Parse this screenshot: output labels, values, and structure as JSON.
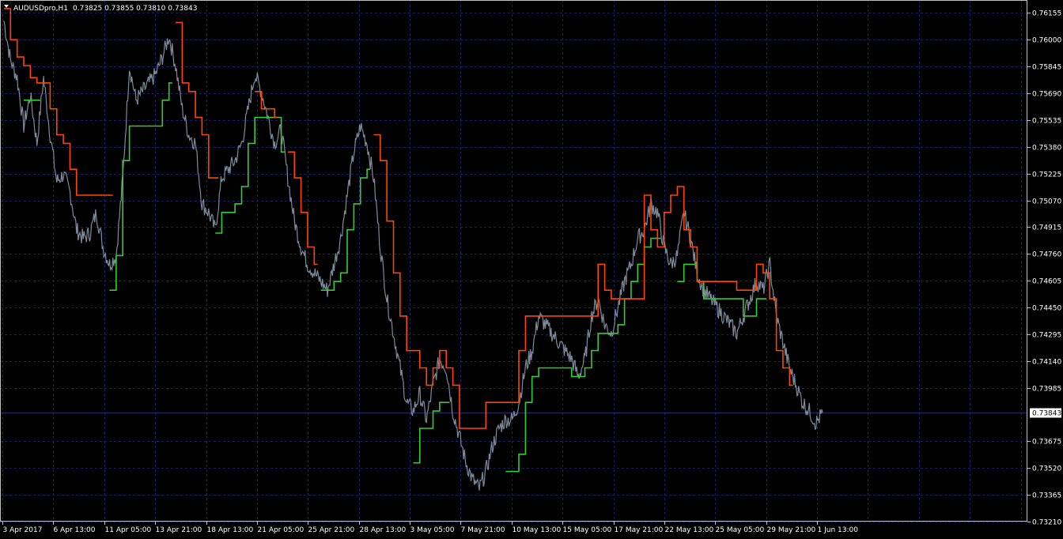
{
  "header": {
    "symbol": "AUDUSDpro,H1",
    "ohlc": "0.73825 0.73855 0.73810 0.73843"
  },
  "colors": {
    "background": "#000000",
    "grid": "#1e1e5a",
    "price": "#7f8a9a",
    "trail_up": "#33cc33",
    "trail_down": "#ff4500",
    "price_marker_bg": "#ffffff",
    "price_marker_line": "#2a2a66"
  },
  "chart_data": {
    "type": "line",
    "ylim": [
      0.7321,
      0.7623
    ],
    "y_ticks": [
      "0.76155",
      "0.76000",
      "0.75845",
      "0.75690",
      "0.75535",
      "0.75380",
      "0.75225",
      "0.75070",
      "0.74915",
      "0.74760",
      "0.74605",
      "0.74450",
      "0.74295",
      "0.74140",
      "0.73985",
      "0.73675",
      "0.73520",
      "0.73365",
      "0.73210"
    ],
    "current_price": "0.73843",
    "x_ticks": [
      "3 Apr 2017",
      "6 Apr 13:00",
      "11 Apr 05:00",
      "13 Apr 21:00",
      "18 Apr 13:00",
      "21 Apr 05:00",
      "25 Apr 21:00",
      "28 Apr 13:00",
      "3 May 05:00",
      "7 May 21:00",
      "10 May 13:00",
      "15 May 05:00",
      "17 May 21:00",
      "22 May 13:00",
      "25 May 05:00",
      "29 May 21:00",
      "1 Jun 13:00"
    ],
    "grid": true,
    "series": [
      {
        "values": [
          0.7611,
          0.7588,
          0.7578,
          0.755,
          0.7568,
          0.754,
          0.7578,
          0.7545,
          0.7518,
          0.7522,
          0.7512,
          0.749,
          0.7485,
          0.7488,
          0.75,
          0.748,
          0.747,
          0.7475,
          0.752,
          0.7585,
          0.7565,
          0.757,
          0.7575,
          0.758,
          0.759,
          0.7602,
          0.7585,
          0.756,
          0.7545,
          0.754,
          0.7505,
          0.75,
          0.749,
          0.752,
          0.7525,
          0.753,
          0.754,
          0.756,
          0.758,
          0.757,
          0.7555,
          0.754,
          0.7548,
          0.752,
          0.7495,
          0.748,
          0.747,
          0.7465,
          0.746,
          0.7455,
          0.747,
          0.7485,
          0.751,
          0.7535,
          0.755,
          0.754,
          0.752,
          0.748,
          0.745,
          0.743,
          0.741,
          0.739,
          0.7385,
          0.7395,
          0.738,
          0.74,
          0.7415,
          0.741,
          0.7385,
          0.737,
          0.7355,
          0.7345,
          0.734,
          0.735,
          0.7365,
          0.7375,
          0.738,
          0.738,
          0.739,
          0.741,
          0.742,
          0.744,
          0.7435,
          0.743,
          0.7425,
          0.742,
          0.7415,
          0.7405,
          0.7415,
          0.744,
          0.745,
          0.7435,
          0.743,
          0.7445,
          0.746,
          0.747,
          0.7485,
          0.749,
          0.7505,
          0.75,
          0.748,
          0.747,
          0.7475,
          0.75,
          0.7485,
          0.7465,
          0.7455,
          0.745,
          0.7445,
          0.744,
          0.7435,
          0.743,
          0.744,
          0.745,
          0.746,
          0.7455,
          0.747,
          0.744,
          0.7425,
          0.741,
          0.74,
          0.739,
          0.7385,
          0.7378,
          0.7384
        ]
      },
      {
        "name_hidden": true,
        "values": [
          null,
          null,
          null,
          0.7565,
          0.7565,
          0.7565,
          null,
          null,
          null,
          null,
          null,
          null,
          null,
          null,
          null,
          null,
          0.7455,
          0.7475,
          0.753,
          0.755,
          0.755,
          0.755,
          0.755,
          0.755,
          0.7565,
          0.7575,
          null,
          null,
          null,
          null,
          null,
          null,
          0.7488,
          0.75,
          0.75,
          0.7505,
          0.7515,
          0.754,
          0.7555,
          0.7555,
          0.7555,
          0.7555,
          0.7535,
          null,
          null,
          null,
          null,
          null,
          0.7455,
          0.7455,
          0.746,
          0.7465,
          0.749,
          0.7505,
          0.752,
          0.7525,
          null,
          null,
          null,
          null,
          null,
          null,
          0.7355,
          0.7375,
          0.7375,
          0.7385,
          0.739,
          0.739,
          null,
          null,
          null,
          null,
          null,
          null,
          null,
          null,
          0.735,
          0.735,
          0.736,
          0.739,
          0.7405,
          0.741,
          0.741,
          0.741,
          0.741,
          0.741,
          0.7405,
          0.7405,
          0.741,
          0.742,
          0.743,
          0.743,
          0.743,
          0.7435,
          0.745,
          0.746,
          0.747,
          0.748,
          0.7485,
          0.7485,
          null,
          null,
          0.746,
          0.747,
          0.747,
          0.746,
          0.745,
          0.745,
          0.745,
          0.745,
          0.745,
          0.745,
          0.744,
          0.744,
          0.745,
          0.745,
          null,
          null,
          null,
          null,
          null,
          null,
          null,
          null,
          null
        ]
      },
      {
        "name_hidden": true,
        "values": [
          0.7618,
          0.76,
          0.759,
          0.7585,
          0.7578,
          0.7575,
          0.7575,
          0.756,
          0.7545,
          0.754,
          0.7525,
          0.751,
          0.751,
          0.751,
          0.751,
          0.751,
          0.751,
          null,
          null,
          null,
          null,
          null,
          null,
          null,
          null,
          null,
          0.761,
          0.7575,
          0.757,
          0.7555,
          0.7545,
          0.752,
          0.752,
          null,
          null,
          null,
          null,
          null,
          0.757,
          0.756,
          0.756,
          0.7555,
          null,
          0.7535,
          0.752,
          0.75,
          0.748,
          0.747,
          null,
          null,
          null,
          null,
          null,
          null,
          null,
          null,
          0.7545,
          0.753,
          0.7495,
          0.7465,
          0.744,
          0.742,
          0.742,
          0.741,
          0.74,
          0.741,
          0.742,
          0.741,
          0.74,
          0.7375,
          0.7375,
          0.7375,
          0.7375,
          0.739,
          0.739,
          0.739,
          0.739,
          0.739,
          0.742,
          0.744,
          0.744,
          0.744,
          0.744,
          0.744,
          0.744,
          0.744,
          0.744,
          0.744,
          0.744,
          0.744,
          0.747,
          0.7455,
          0.745,
          0.745,
          0.745,
          0.745,
          0.745,
          0.751,
          0.749,
          0.748,
          0.75,
          0.751,
          0.7515,
          0.749,
          0.748,
          0.746,
          0.746,
          0.746,
          0.746,
          0.746,
          0.746,
          0.7455,
          0.7455,
          0.7455,
          0.747,
          0.7465,
          0.745,
          0.742,
          0.741,
          0.74,
          null,
          null,
          null
        ]
      }
    ]
  }
}
